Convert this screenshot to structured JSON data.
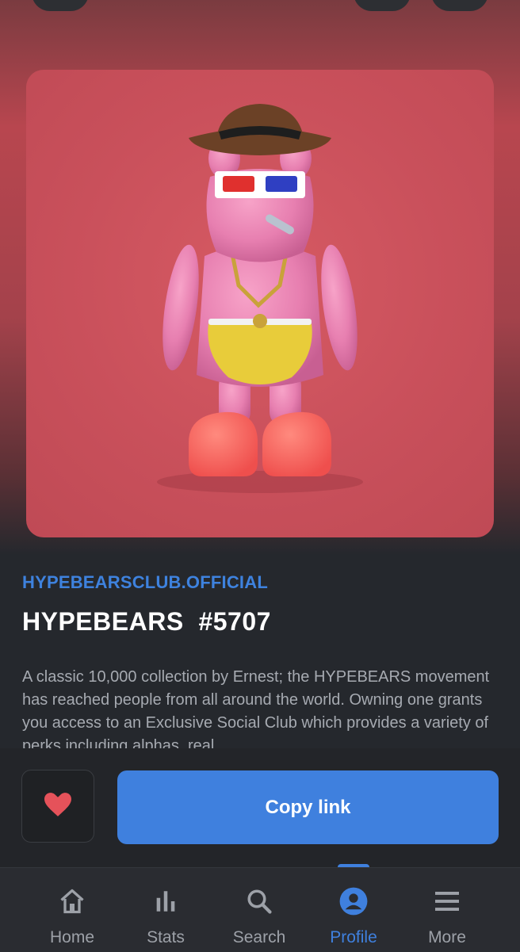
{
  "nft": {
    "collection": "HYPEBEARSCLUB.OFFICIAL",
    "title": "HYPEBEARS  #5707",
    "description": "A classic 10,000 collection by Ernest; the HYPEBEARS movement has reached people from all around the world. Owning one grants you access to an Exclusive Social Club which provides a variety of perks including alphas, real"
  },
  "actions": {
    "favorite_icon": "heart-icon",
    "copy_label": "Copy link"
  },
  "nav": {
    "items": [
      {
        "label": "Home",
        "icon": "home-icon"
      },
      {
        "label": "Stats",
        "icon": "bar-chart-icon"
      },
      {
        "label": "Search",
        "icon": "search-icon"
      },
      {
        "label": "Profile",
        "icon": "profile-icon",
        "active": true
      },
      {
        "label": "More",
        "icon": "menu-icon"
      }
    ]
  },
  "colors": {
    "accent": "#3f80de",
    "heart": "#e5525a",
    "background": "#25282d"
  }
}
